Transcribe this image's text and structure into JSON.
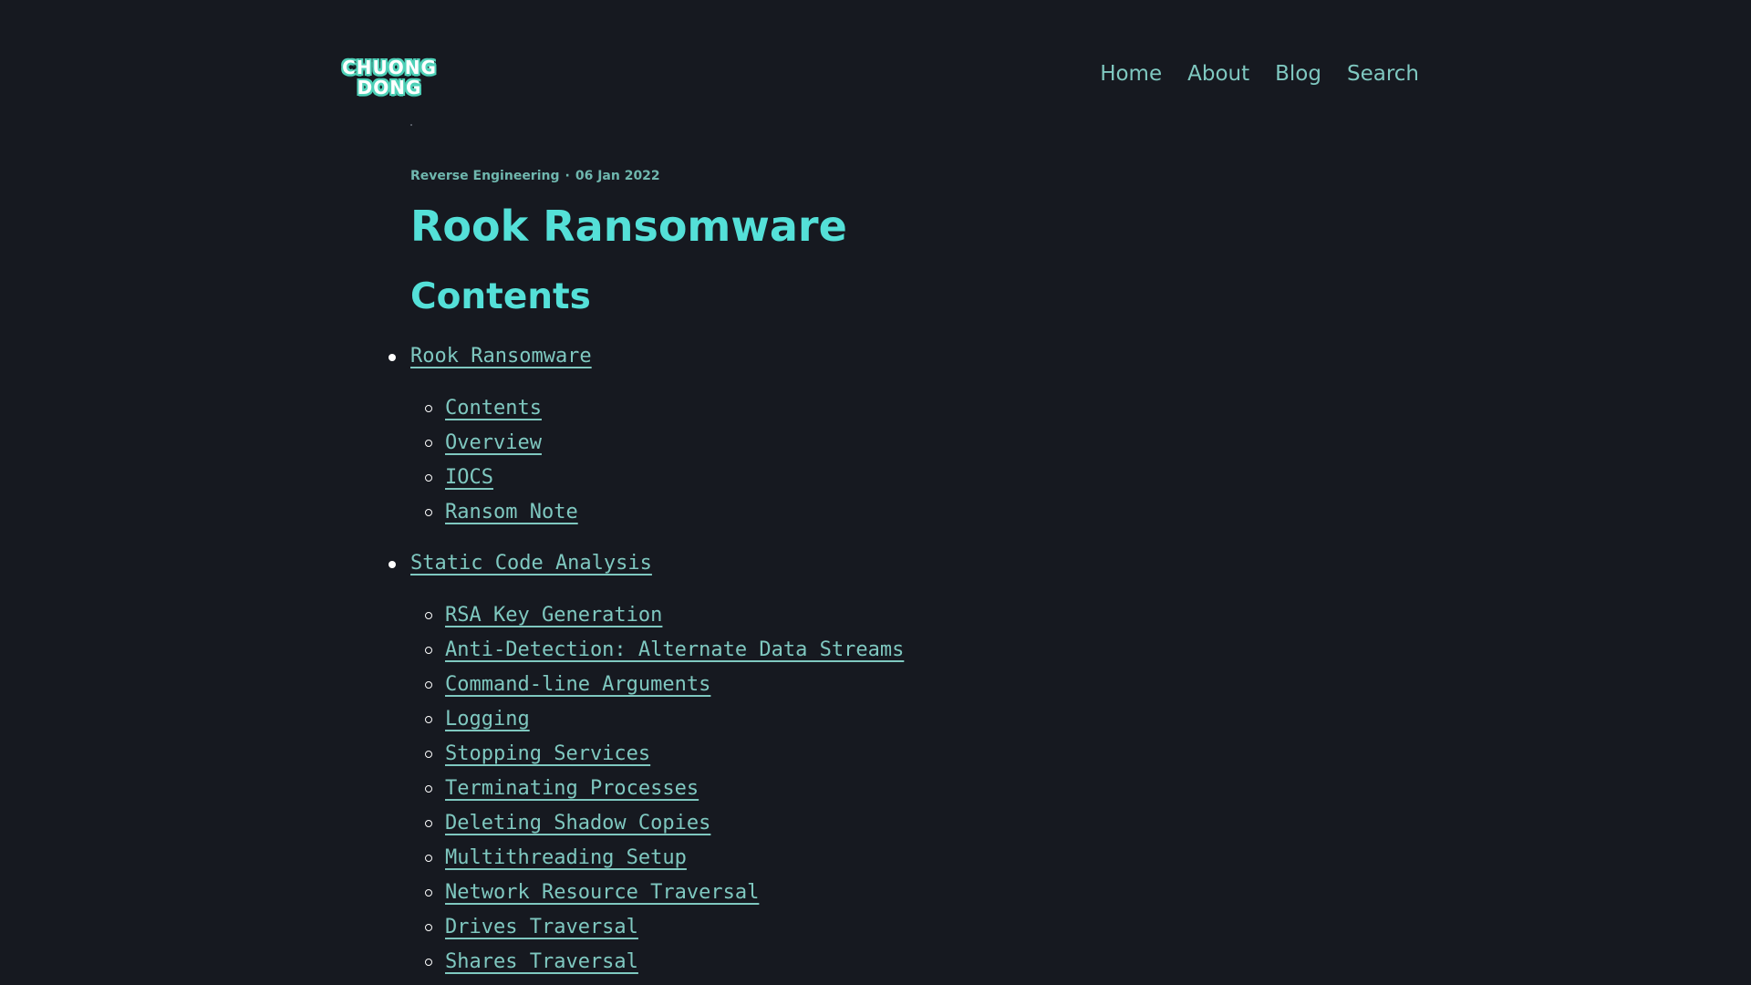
{
  "header": {
    "logo_line1": "CHUONG",
    "logo_line2": "DONG",
    "nav": [
      {
        "label": "Home"
      },
      {
        "label": "About"
      },
      {
        "label": "Blog"
      },
      {
        "label": "Search"
      }
    ]
  },
  "post": {
    "category": "Reverse Engineering",
    "separator": "·",
    "date": "06 Jan 2022",
    "title": "Rook Ransomware"
  },
  "contents": {
    "heading": "Contents",
    "sections": [
      {
        "label": "Rook Ransomware",
        "children": [
          "Contents",
          "Overview",
          "IOCS",
          "Ransom Note"
        ]
      },
      {
        "label": "Static Code Analysis",
        "children": [
          "RSA Key Generation",
          "Anti-Detection: Alternate Data Streams",
          "Command-line Arguments",
          "Logging",
          "Stopping Services",
          "Terminating Processes",
          "Deleting Shadow Copies",
          "Multithreading Setup",
          "Network Resource Traversal",
          "Drives Traversal",
          "Shares Traversal"
        ]
      }
    ]
  },
  "colors": {
    "background": "#161920",
    "link": "#7fc8c0",
    "heading": "#54e0d8",
    "bullet": "#ffffff"
  }
}
